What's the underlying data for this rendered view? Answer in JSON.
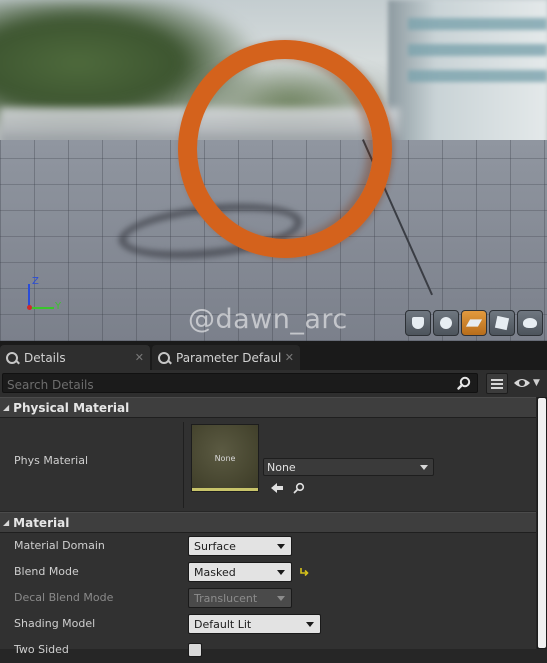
{
  "viewport": {
    "watermark": "@dawn_arc",
    "axis": {
      "z_label": "Z",
      "y_label": "Y"
    },
    "preview_tools": [
      "cylinder-icon",
      "sphere-icon",
      "plane-icon",
      "cube-icon",
      "teapot-icon"
    ],
    "active_tool": "plane-icon"
  },
  "tabs": [
    {
      "label": "Details",
      "close": "✕",
      "active": true
    },
    {
      "label": "Parameter Defaults",
      "close": "✕",
      "active": false
    }
  ],
  "search": {
    "placeholder": "Search Details",
    "value": ""
  },
  "categories": {
    "physical_material": {
      "label": "Physical Material",
      "phys_material": {
        "name": "Phys Material",
        "thumbnail_text": "None",
        "value": "None"
      }
    },
    "material": {
      "label": "Material",
      "properties": [
        {
          "name": "Material Domain",
          "value": "Surface",
          "enabled": true
        },
        {
          "name": "Blend Mode",
          "value": "Masked",
          "enabled": true,
          "modified": true
        },
        {
          "name": "Decal Blend Mode",
          "value": "Translucent",
          "enabled": false
        },
        {
          "name": "Shading Model",
          "value": "Default Lit",
          "enabled": true
        },
        {
          "name": "Two Sided",
          "value": "",
          "enabled": true
        }
      ]
    }
  },
  "colors": {
    "ring": "#d4621c",
    "accent_active": "#e29a3e",
    "panel_bg": "#313131",
    "category_bg": "#3e3e3e"
  }
}
